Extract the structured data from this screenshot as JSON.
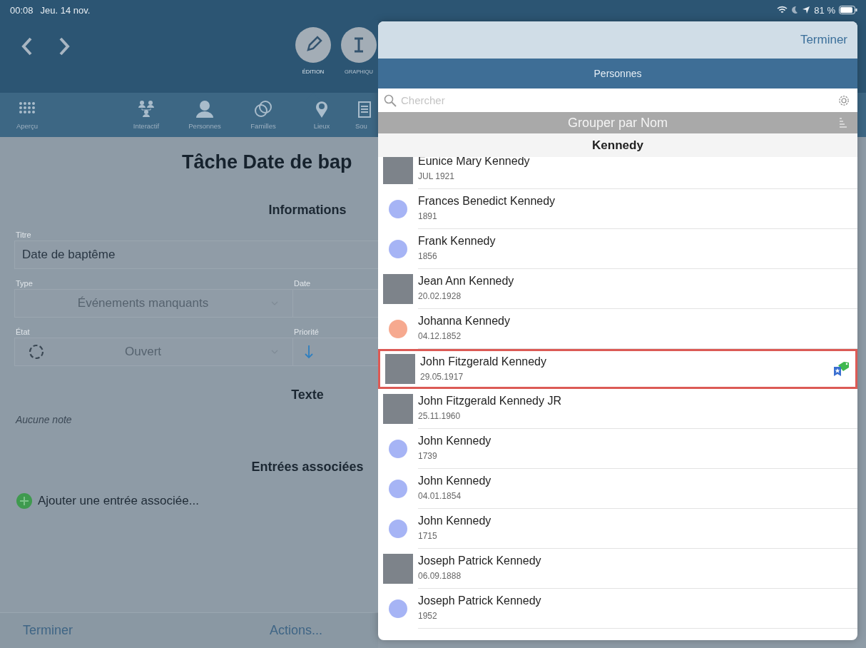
{
  "status_bar": {
    "time": "00:08",
    "date": "Jeu. 14 nov.",
    "battery": "81 %"
  },
  "toolbar": {
    "modes": [
      {
        "label": "ÉDITION",
        "selected": true
      },
      {
        "label": "GRAPHIQU",
        "selected": false
      }
    ]
  },
  "tabs": [
    {
      "label": "Aperçu"
    },
    {
      "label": "Interactif"
    },
    {
      "label": "Personnes"
    },
    {
      "label": "Familles"
    },
    {
      "label": "Lieux"
    },
    {
      "label": "Sou"
    }
  ],
  "form": {
    "title": "Tâche Date de bap",
    "info_heading": "Informations",
    "titre": {
      "label": "Titre",
      "value": "Date de baptême"
    },
    "type": {
      "label": "Type",
      "value": "Événements manquants"
    },
    "date": {
      "label": "Date"
    },
    "etat": {
      "label": "État",
      "value": "Ouvert"
    },
    "priorite": {
      "label": "Priorité"
    },
    "text_heading": "Texte",
    "note": "Aucune note",
    "related_heading": "Entrées associées",
    "add_related": "Ajouter une entrée associée..."
  },
  "bottom_bar": {
    "done": "Terminer",
    "actions": "Actions..."
  },
  "picker": {
    "done": "Terminer",
    "title": "Personnes",
    "search": {
      "placeholder": "Chercher"
    },
    "group_by": "Grouper par Nom",
    "section": "Kennedy",
    "rows": [
      {
        "name": "Eunice Mary Kennedy",
        "date": "JUL 1921",
        "kind": "photo",
        "selected": false,
        "tagged": false
      },
      {
        "name": "Frances Benedict Kennedy",
        "date": "1891",
        "kind": "circle",
        "color": "#a6b4f5",
        "selected": false,
        "tagged": false
      },
      {
        "name": "Frank Kennedy",
        "date": "1856",
        "kind": "circle",
        "color": "#a6b4f5",
        "selected": false,
        "tagged": false
      },
      {
        "name": "Jean Ann Kennedy",
        "date": "20.02.1928",
        "kind": "photo",
        "selected": false,
        "tagged": false
      },
      {
        "name": "Johanna Kennedy",
        "date": "04.12.1852",
        "kind": "circle",
        "color": "#f6a98f",
        "selected": false,
        "tagged": false
      },
      {
        "name": "John Fitzgerald Kennedy",
        "date": "29.05.1917",
        "kind": "photo",
        "selected": true,
        "tagged": true
      },
      {
        "name": "John Fitzgerald Kennedy JR",
        "date": "25.11.1960",
        "kind": "photo",
        "selected": false,
        "tagged": false
      },
      {
        "name": "John Kennedy",
        "date": "1739",
        "kind": "circle",
        "color": "#a6b4f5",
        "selected": false,
        "tagged": false
      },
      {
        "name": "John Kennedy",
        "date": "04.01.1854",
        "kind": "circle",
        "color": "#a6b4f5",
        "selected": false,
        "tagged": false
      },
      {
        "name": "John Kennedy",
        "date": "1715",
        "kind": "circle",
        "color": "#a6b4f5",
        "selected": false,
        "tagged": false
      },
      {
        "name": "Joseph Patrick Kennedy",
        "date": "06.09.1888",
        "kind": "photo",
        "selected": false,
        "tagged": false
      },
      {
        "name": "Joseph Patrick Kennedy",
        "date": "1952",
        "kind": "circle",
        "color": "#a6b4f5",
        "selected": false,
        "tagged": false
      }
    ]
  }
}
